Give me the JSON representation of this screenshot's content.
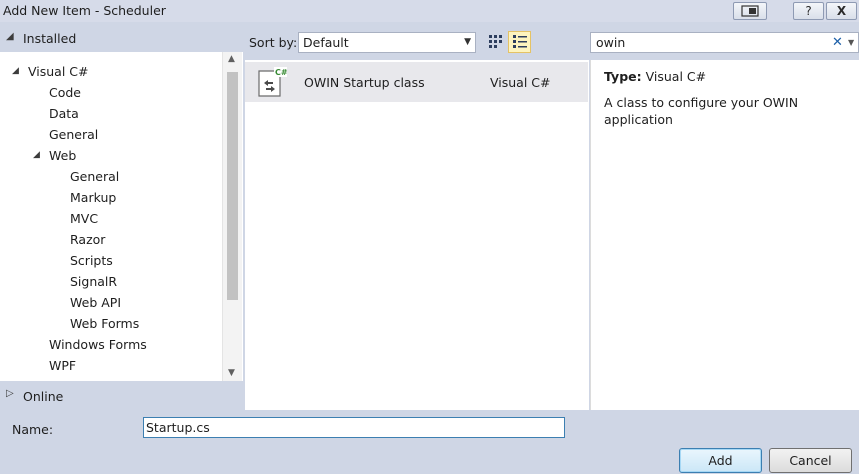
{
  "window": {
    "title": "Add New Item - Scheduler",
    "help_label": "?",
    "close_label": "X"
  },
  "sidebar": {
    "installed_label": "Installed",
    "items": [
      {
        "label": "Visual C#",
        "expanded": true
      },
      {
        "label": "Code"
      },
      {
        "label": "Data"
      },
      {
        "label": "General"
      },
      {
        "label": "Web",
        "expanded": true
      },
      {
        "label": "General"
      },
      {
        "label": "Markup"
      },
      {
        "label": "MVC"
      },
      {
        "label": "Razor"
      },
      {
        "label": "Scripts"
      },
      {
        "label": "SignalR"
      },
      {
        "label": "Web API"
      },
      {
        "label": "Web Forms"
      },
      {
        "label": "Windows Forms"
      },
      {
        "label": "WPF"
      }
    ],
    "online_label": "Online"
  },
  "toolbar": {
    "sort_by_label": "Sort by:",
    "sort_value": "Default",
    "search_value": "owin"
  },
  "templates": [
    {
      "name": "OWIN Startup class",
      "language": "Visual C#",
      "icon": "csharp-file-icon"
    }
  ],
  "details": {
    "type_label": "Type:",
    "type_value": "Visual C#",
    "description": "A class to configure your OWIN application"
  },
  "footer": {
    "name_label": "Name:",
    "name_value": "Startup.cs",
    "add_label": "Add",
    "cancel_label": "Cancel"
  }
}
